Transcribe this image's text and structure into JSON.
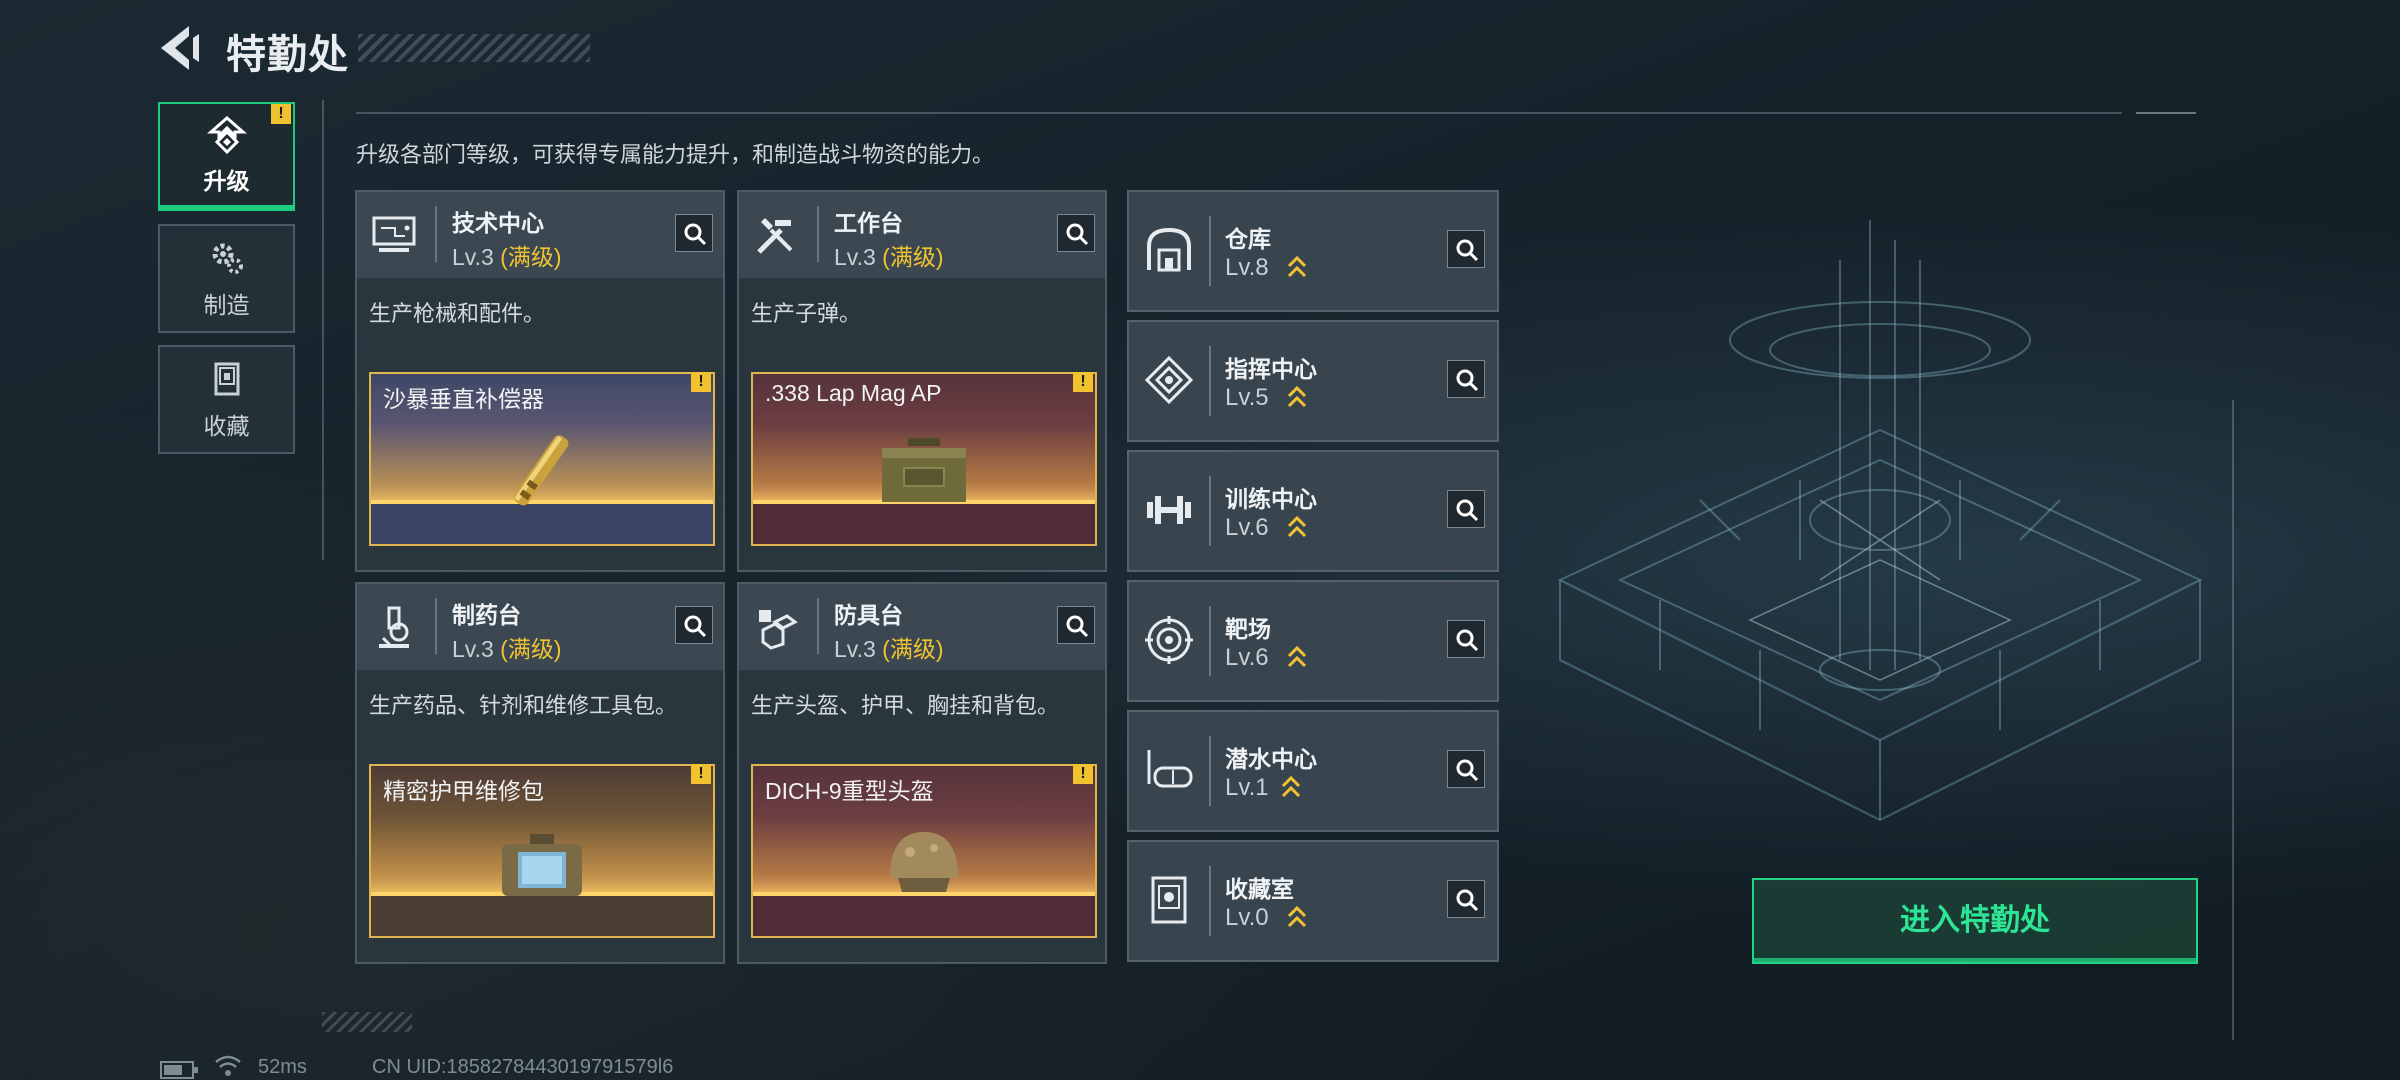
{
  "header": {
    "title": "特勤处"
  },
  "sidebar": {
    "tabs": [
      {
        "label": "升级",
        "icon": "upgrade-icon",
        "active": true,
        "warning": "!"
      },
      {
        "label": "制造",
        "icon": "gears-icon",
        "active": false
      },
      {
        "label": "收藏",
        "icon": "collection-icon",
        "active": false
      }
    ]
  },
  "main": {
    "description": "升级各部门等级，可获得专属能力提升，和制造战斗物资的能力。",
    "workshops": [
      {
        "name": "技术中心",
        "level": "Lv.3",
        "status": "(满级)",
        "desc": "生产枪械和配件。",
        "item": {
          "name": "沙暴垂直补偿器",
          "warning": "!"
        }
      },
      {
        "name": "工作台",
        "level": "Lv.3",
        "status": "(满级)",
        "desc": "生产子弹。",
        "item": {
          "name": ".338 Lap Mag AP",
          "warning": "!"
        }
      },
      {
        "name": "制药台",
        "level": "Lv.3",
        "status": "(满级)",
        "desc": "生产药品、针剂和维修工具包。",
        "item": {
          "name": "精密护甲维修包",
          "warning": "!"
        }
      },
      {
        "name": "防具台",
        "level": "Lv.3",
        "status": "(满级)",
        "desc": "生产头盔、护甲、胸挂和背包。",
        "item": {
          "name": "DICH-9重型头盔",
          "warning": "!"
        }
      }
    ],
    "facilities": [
      {
        "name": "仓库",
        "level": "Lv.8"
      },
      {
        "name": "指挥中心",
        "level": "Lv.5"
      },
      {
        "name": "训练中心",
        "level": "Lv.6"
      },
      {
        "name": "靶场",
        "level": "Lv.6"
      },
      {
        "name": "潜水中心",
        "level": "Lv.1"
      },
      {
        "name": "收藏室",
        "level": "Lv.0"
      }
    ],
    "enter_button": "进入特勤处"
  },
  "status_bar": {
    "ping": "52ms",
    "uid": "CN UID:1858278443019791579l6"
  },
  "colors": {
    "accent_green": "#22d486",
    "gold": "#f1c232",
    "panel": "#3b4852"
  }
}
